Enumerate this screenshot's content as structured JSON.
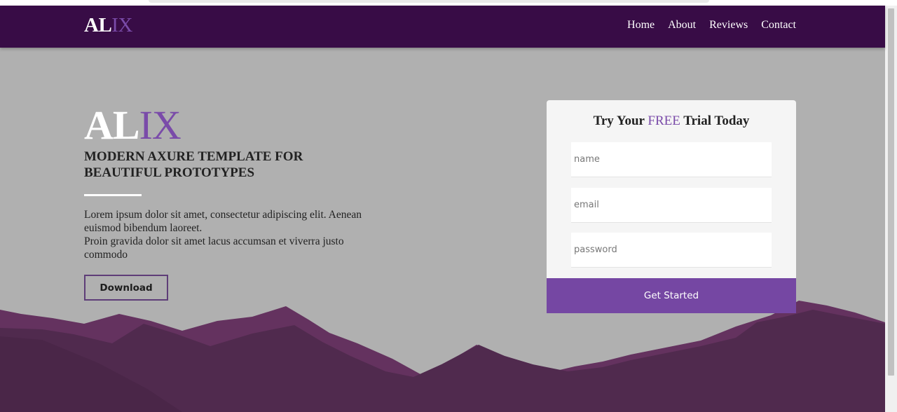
{
  "brand": {
    "logo_white": "AL",
    "logo_purple": "IX"
  },
  "nav": {
    "items": [
      "Home",
      "About",
      "Reviews",
      "Contact"
    ]
  },
  "hero": {
    "title_white": "AL",
    "title_purple": "IX",
    "subtitle": "MODERN AXURE TEMPLATE FOR BEAUTIFUL PROTOTYPES",
    "body_lines": [
      "Lorem ipsum dolor sit amet, consectetur adipiscing elit. Aenean euismod bibendum laoreet.",
      "Proin gravida dolor sit amet lacus accumsan et viverra justo commodo"
    ],
    "download_label": "Download"
  },
  "form": {
    "title_before": "Try Your ",
    "title_highlight": "FREE",
    "title_after": " Trial Today",
    "name_placeholder": "name",
    "email_placeholder": "email",
    "password_placeholder": "password",
    "submit_label": "Get Started"
  },
  "colors": {
    "navbar": "#380c46",
    "accent": "#7a4ba9",
    "button": "#7547a3",
    "background": "#b0b0b0",
    "mountain_dark": "#502a4e",
    "mountain_light": "#64325f"
  }
}
